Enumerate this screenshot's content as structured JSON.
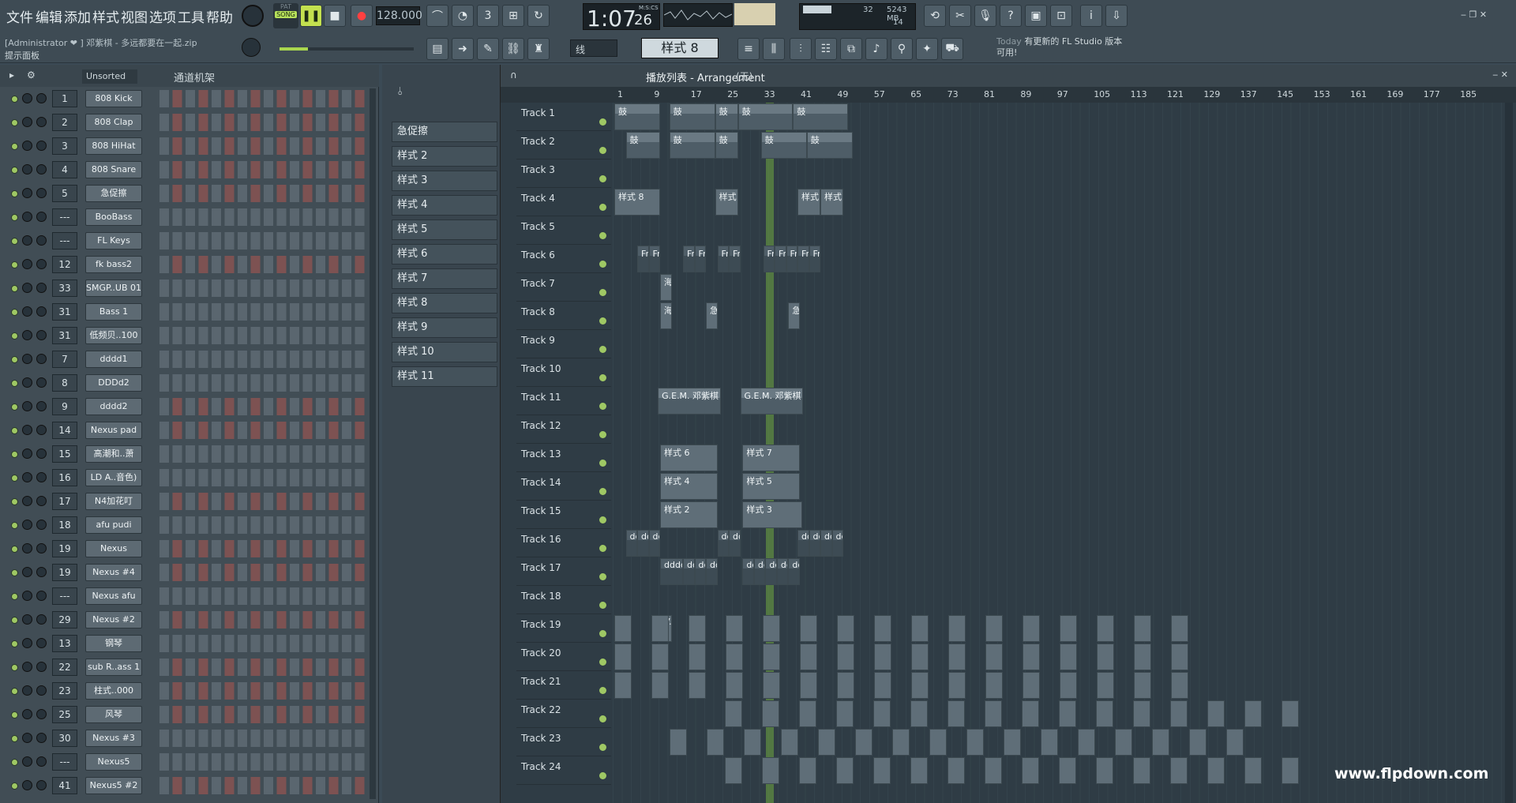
{
  "menu": [
    "文件",
    "编辑",
    "添加",
    "样式",
    "视图",
    "选项",
    "工具",
    "帮助"
  ],
  "transport": {
    "pat_label": "PAT",
    "song_label": "SONG",
    "tempo": "128.000",
    "time": "1:07",
    "time_small": "26",
    "time_unit": "M:S:CS",
    "cpu": "32",
    "mem": "5243 MB",
    "poly": "14"
  },
  "project": {
    "user": "[Administrator ❤",
    "file": "] 邓紫棋 - 多远都要在一起.zip",
    "hint": "提示面板"
  },
  "toolbar2": {
    "snap": "线",
    "pattern": "样式 8",
    "news_day": "Today",
    "news_text": "有更新的 FL Studio 版本可用!"
  },
  "rack": {
    "filter": "Unsorted",
    "title": "通道机架"
  },
  "channels": [
    {
      "n": "1",
      "name": "808 Kick"
    },
    {
      "n": "2",
      "name": "808 Clap"
    },
    {
      "n": "3",
      "name": "808 HiHat"
    },
    {
      "n": "4",
      "name": "808 Snare"
    },
    {
      "n": "5",
      "name": "急促擦"
    },
    {
      "n": "---",
      "name": "BooBass"
    },
    {
      "n": "---",
      "name": "FL Keys"
    },
    {
      "n": "12",
      "name": "fk bass2"
    },
    {
      "n": "33",
      "name": "SMGP..UB 01"
    },
    {
      "n": "31",
      "name": "Bass 1"
    },
    {
      "n": "31",
      "name": "低频贝..100"
    },
    {
      "n": "7",
      "name": "dddd1"
    },
    {
      "n": "8",
      "name": "DDDd2"
    },
    {
      "n": "9",
      "name": "dddd2"
    },
    {
      "n": "14",
      "name": "Nexus pad"
    },
    {
      "n": "15",
      "name": "高潮和..萧"
    },
    {
      "n": "16",
      "name": "LD A..音色)"
    },
    {
      "n": "17",
      "name": "N4加花叮"
    },
    {
      "n": "18",
      "name": "afu pudi"
    },
    {
      "n": "19",
      "name": "Nexus"
    },
    {
      "n": "19",
      "name": "Nexus #4"
    },
    {
      "n": "---",
      "name": "Nexus afu"
    },
    {
      "n": "29",
      "name": "Nexus #2"
    },
    {
      "n": "13",
      "name": "钢琴"
    },
    {
      "n": "22",
      "name": "sub R..ass 1"
    },
    {
      "n": "23",
      "name": "柱式..000"
    },
    {
      "n": "25",
      "name": "风琴"
    },
    {
      "n": "30",
      "name": "Nexus #3"
    },
    {
      "n": "---",
      "name": "Nexus5"
    },
    {
      "n": "41",
      "name": "Nexus5 #2"
    }
  ],
  "patterns": [
    "急促擦",
    "样式 2",
    "样式 3",
    "样式 4",
    "样式 5",
    "样式 6",
    "样式 7",
    "样式 8",
    "样式 9",
    "样式 10",
    "样式 11"
  ],
  "playlist": {
    "title": "播放列表 - Arrangement",
    "sub": "(无)",
    "watermark": "www.flpdown.com"
  },
  "ruler": [
    "1",
    "9",
    "17",
    "25",
    "33",
    "41",
    "49",
    "57",
    "65",
    "73",
    "81",
    "89",
    "97",
    "105",
    "113",
    "121",
    "129",
    "137",
    "145",
    "153",
    "161",
    "169",
    "177",
    "185"
  ],
  "tracks": [
    "Track 1",
    "Track 2",
    "Track 3",
    "Track 4",
    "Track 5",
    "Track 6",
    "Track 7",
    "Track 8",
    "Track 9",
    "Track 10",
    "Track 11",
    "Track 12",
    "Track 13",
    "Track 14",
    "Track 15",
    "Track 16",
    "Track 17",
    "Track 18",
    "Track 19",
    "Track 20",
    "Track 21",
    "Track 22",
    "Track 23",
    "Track 24"
  ],
  "clips": {
    "drum": "鼓",
    "p8": "样式 8",
    "p9": "样式 9",
    "p10": "样式 10",
    "p11": "样式 11",
    "fr": "Fr.. 率",
    "sea": "海..声",
    "seafx": "海..效",
    "rush": "急..擦",
    "gem": "G.E.M. 邓紫棋 - 多远都要在一起",
    "p6": "样式 6",
    "p7": "样式 7",
    "p4": "样式 4",
    "p5": "样式 5",
    "p2": "样式 2",
    "p3": "样式 3",
    "ddoff": "dd..off",
    "dddd": "dddd1 -..l Cutoff",
    "vr": "V..r 02"
  }
}
